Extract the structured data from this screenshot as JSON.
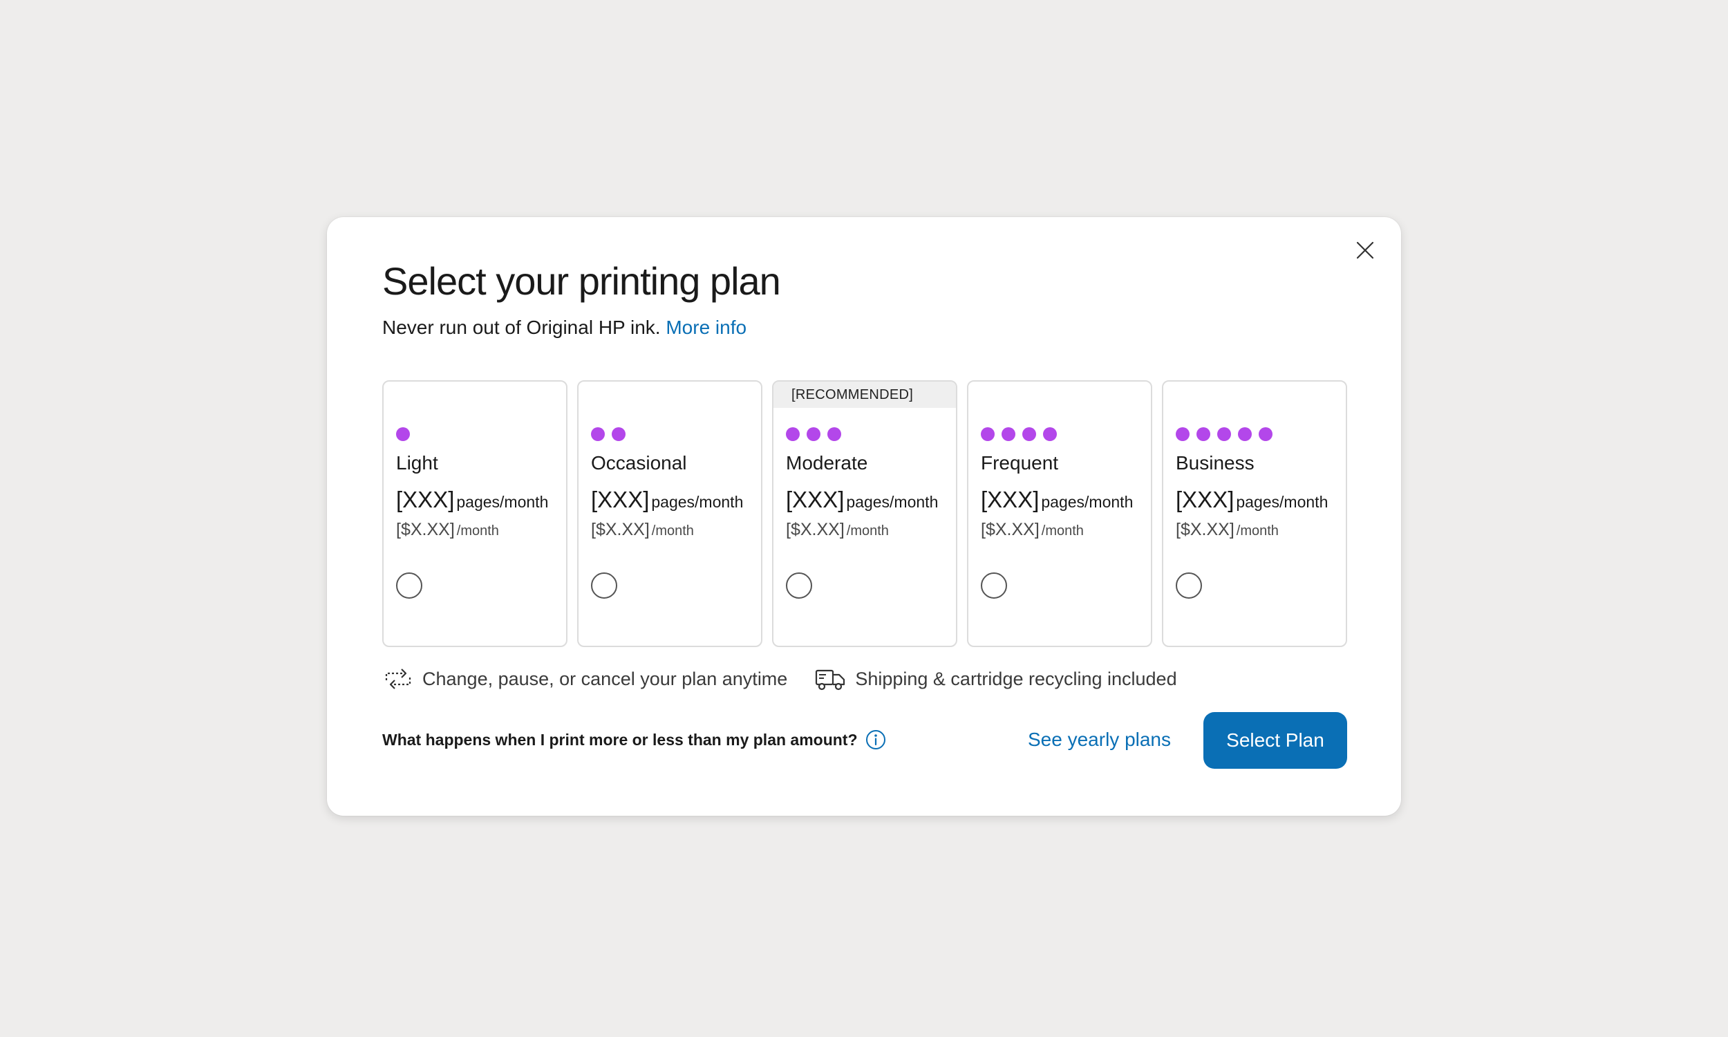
{
  "modal": {
    "title": "Select your printing plan",
    "subtitle": "Never run out of Original HP ink.",
    "more_info_link": "More info",
    "close_icon": "close-icon"
  },
  "plans": [
    {
      "name": "Light",
      "dots": 1,
      "pages_value": "[XXX]",
      "pages_unit": "pages/month",
      "price_value": "[$X.XX]",
      "price_unit": "/month",
      "selected": false
    },
    {
      "name": "Occasional",
      "dots": 2,
      "pages_value": "[XXX]",
      "pages_unit": "pages/month",
      "price_value": "[$X.XX]",
      "price_unit": "/month",
      "selected": false
    },
    {
      "name": "Moderate",
      "dots": 3,
      "badge": "[RECOMMENDED]",
      "pages_value": "[XXX]",
      "pages_unit": "pages/month",
      "price_value": "[$X.XX]",
      "price_unit": "/month",
      "selected": false
    },
    {
      "name": "Frequent",
      "dots": 4,
      "pages_value": "[XXX]",
      "pages_unit": "pages/month",
      "price_value": "[$X.XX]",
      "price_unit": "/month",
      "selected": false
    },
    {
      "name": "Business",
      "dots": 5,
      "pages_value": "[XXX]",
      "pages_unit": "pages/month",
      "price_value": "[$X.XX]",
      "price_unit": "/month",
      "selected": false
    }
  ],
  "features": [
    {
      "icon": "change-plan-icon",
      "text": "Change, pause, or cancel your plan anytime"
    },
    {
      "icon": "shipping-truck-icon",
      "text": "Shipping & cartridge recycling included"
    }
  ],
  "footer": {
    "question": "What happens when I print more or less than my plan amount?",
    "info_icon": "info-icon",
    "yearly_link": "See yearly plans",
    "select_button": "Select Plan"
  },
  "colors": {
    "page_background": "#eeedec",
    "accent_blue": "#0a6fb5",
    "dot_purple": "#b347ea",
    "card_border": "#dcdcdc",
    "badge_background": "#efefef"
  }
}
